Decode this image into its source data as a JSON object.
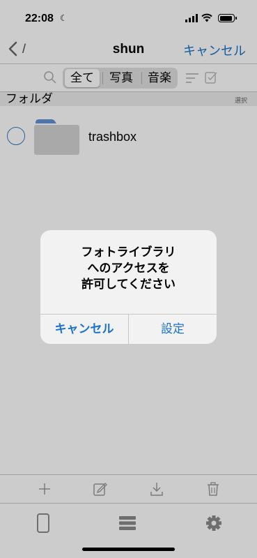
{
  "status_bar": {
    "time": "22:08"
  },
  "nav": {
    "path": "/",
    "title": "shun",
    "cancel_label": "キャンセル"
  },
  "filter": {
    "segments": [
      "全て",
      "写真",
      "音楽"
    ],
    "selected": "全て"
  },
  "section": {
    "title": "フォルダ",
    "select_label": "選択"
  },
  "files": [
    {
      "name": "trashbox",
      "type": "folder"
    }
  ],
  "toolbar": {
    "icons": [
      "plus-icon",
      "edit-icon",
      "download-icon",
      "trash-icon"
    ]
  },
  "tabbar": {
    "icons": [
      "device-icon",
      "list-icon",
      "gear-icon"
    ]
  },
  "alert": {
    "title_lines": [
      "フォトライブラリ",
      "へのアクセスを",
      "許可してください"
    ],
    "cancel_label": "キャンセル",
    "settings_label": "設定"
  },
  "colors": {
    "accent": "#1a73c8",
    "dim": "rgba(0,0,0,0.2)"
  }
}
